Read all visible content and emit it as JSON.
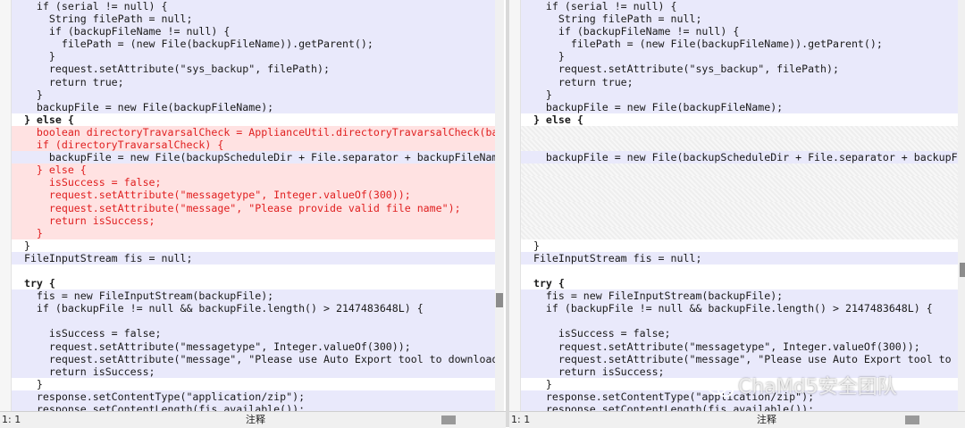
{
  "left_pane": {
    "lines": [
      {
        "text": "    if (serial != null) {",
        "style": "c",
        "arrow": false
      },
      {
        "text": "      String filePath = null;",
        "style": "c",
        "arrow": false
      },
      {
        "text": "      if (backupFileName != null) {",
        "style": "c",
        "arrow": false
      },
      {
        "text": "        filePath = (new File(backupFileName)).getParent();",
        "style": "c",
        "arrow": false
      },
      {
        "text": "      }",
        "style": "c",
        "arrow": false
      },
      {
        "text": "      request.setAttribute(\"sys_backup\", filePath);",
        "style": "c",
        "arrow": true
      },
      {
        "text": "      return true;",
        "style": "c",
        "arrow": false
      },
      {
        "text": "    }",
        "style": "c",
        "arrow": false
      },
      {
        "text": "    backupFile = new File(backupFileName);",
        "style": "c",
        "arrow": true
      },
      {
        "text": "  } else {",
        "style": "w",
        "arrow": false
      },
      {
        "text": "    boolean directoryTravarsalCheck = ApplianceUtil.directoryTravarsalCheck(backupF",
        "style": "d",
        "arrow": false
      },
      {
        "text": "    if (directoryTravarsalCheck) {",
        "style": "d",
        "arrow": false
      },
      {
        "text": "      backupFile = new File(backupScheduleDir + File.separator + backupFileName);",
        "style": "c",
        "arrow": true
      },
      {
        "text": "    } else {",
        "style": "d",
        "arrow": false
      },
      {
        "text": "      isSuccess = false;",
        "style": "d",
        "arrow": false
      },
      {
        "text": "      request.setAttribute(\"messagetype\", Integer.valueOf(300));",
        "style": "d",
        "arrow": false
      },
      {
        "text": "      request.setAttribute(\"message\", \"Please provide valid file name\");",
        "style": "d",
        "arrow": false
      },
      {
        "text": "      return isSuccess;",
        "style": "d",
        "arrow": false
      },
      {
        "text": "    }",
        "style": "d",
        "arrow": false
      },
      {
        "text": "  }",
        "style": "w",
        "arrow": false
      },
      {
        "text": "  FileInputStream fis = null;",
        "style": "c",
        "arrow": true
      },
      {
        "text": "",
        "style": "w",
        "arrow": false
      },
      {
        "text": "  try {",
        "style": "w",
        "arrow": false
      },
      {
        "text": "    fis = new FileInputStream(backupFile);",
        "style": "c",
        "arrow": false
      },
      {
        "text": "    if (backupFile != null && backupFile.length() > 2147483648L) {",
        "style": "c",
        "arrow": false
      },
      {
        "text": "",
        "style": "c",
        "arrow": false
      },
      {
        "text": "      isSuccess = false;",
        "style": "c",
        "arrow": false
      },
      {
        "text": "      request.setAttribute(\"messagetype\", Integer.valueOf(300));",
        "style": "c",
        "arrow": false
      },
      {
        "text": "      request.setAttribute(\"message\", \"Please use Auto Export tool to download file",
        "style": "c",
        "arrow": false
      },
      {
        "text": "      return isSuccess;",
        "style": "c",
        "arrow": false
      },
      {
        "text": "    }",
        "style": "w",
        "arrow": false
      },
      {
        "text": "    response.setContentType(\"application/zip\");",
        "style": "c",
        "arrow": true
      },
      {
        "text": "    response.setContentLength(fis.available());",
        "style": "c",
        "arrow": false
      }
    ]
  },
  "right_pane": {
    "lines": [
      {
        "text": "    if (serial != null) {",
        "style": "c",
        "arrow": false
      },
      {
        "text": "      String filePath = null;",
        "style": "c",
        "arrow": false
      },
      {
        "text": "      if (backupFileName != null) {",
        "style": "c",
        "arrow": false
      },
      {
        "text": "        filePath = (new File(backupFileName)).getParent();",
        "style": "c",
        "arrow": false
      },
      {
        "text": "      }",
        "style": "c",
        "arrow": false
      },
      {
        "text": "      request.setAttribute(\"sys_backup\", filePath);",
        "style": "c",
        "arrow": true
      },
      {
        "text": "      return true;",
        "style": "c",
        "arrow": false
      },
      {
        "text": "    }",
        "style": "c",
        "arrow": false
      },
      {
        "text": "    backupFile = new File(backupFileName);",
        "style": "c",
        "arrow": true
      },
      {
        "text": "  } else {",
        "style": "w",
        "arrow": false
      },
      {
        "text": "",
        "style": "p",
        "arrow": false
      },
      {
        "text": "",
        "style": "p",
        "arrow": false
      },
      {
        "text": "    backupFile = new File(backupScheduleDir + File.separator + backupFileNa",
        "style": "c",
        "arrow": true
      },
      {
        "text": "",
        "style": "p",
        "arrow": false
      },
      {
        "text": "",
        "style": "p",
        "arrow": false
      },
      {
        "text": "",
        "style": "p",
        "arrow": false
      },
      {
        "text": "",
        "style": "p",
        "arrow": false
      },
      {
        "text": "",
        "style": "p",
        "arrow": false
      },
      {
        "text": "",
        "style": "p",
        "arrow": false
      },
      {
        "text": "  }",
        "style": "w",
        "arrow": false
      },
      {
        "text": "  FileInputStream fis = null;",
        "style": "c",
        "arrow": true
      },
      {
        "text": "",
        "style": "w",
        "arrow": false
      },
      {
        "text": "  try {",
        "style": "w",
        "arrow": false
      },
      {
        "text": "    fis = new FileInputStream(backupFile);",
        "style": "c",
        "arrow": false
      },
      {
        "text": "    if (backupFile != null && backupFile.length() > 2147483648L) {",
        "style": "c",
        "arrow": false
      },
      {
        "text": "",
        "style": "c",
        "arrow": false
      },
      {
        "text": "      isSuccess = false;",
        "style": "c",
        "arrow": false
      },
      {
        "text": "      request.setAttribute(\"messagetype\", Integer.valueOf(300));",
        "style": "c",
        "arrow": false
      },
      {
        "text": "      request.setAttribute(\"message\", \"Please use Auto Export tool to downl",
        "style": "c",
        "arrow": false
      },
      {
        "text": "      return isSuccess;",
        "style": "c",
        "arrow": false
      },
      {
        "text": "    }",
        "style": "w",
        "arrow": false
      },
      {
        "text": "    response.setContentType(\"application/zip\");",
        "style": "c",
        "arrow": true
      },
      {
        "text": "    response.setContentLength(fis.available());",
        "style": "c",
        "arrow": false
      }
    ]
  },
  "status_left": {
    "position": "1: 1",
    "comment": "注释"
  },
  "status_right": {
    "position": "1: 1",
    "comment": "注释"
  },
  "watermark": "ChaMd5安全团队",
  "colors": {
    "changed_line": "#e9e9fb",
    "deleted_line": "#ffe2e2",
    "deleted_text": "#e02020",
    "arrow": "#d9a000"
  }
}
